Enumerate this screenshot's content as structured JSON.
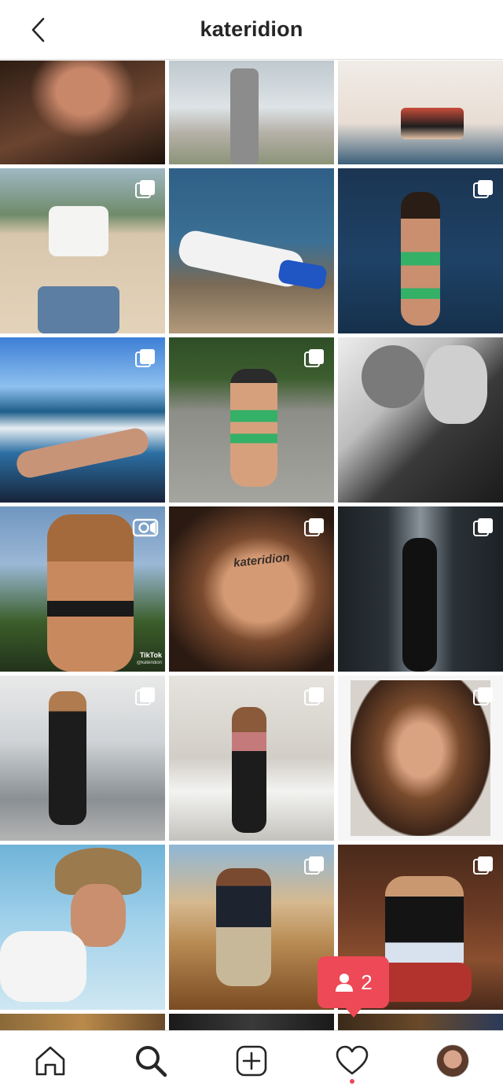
{
  "header": {
    "title": "kateridion",
    "back_icon": "chevron-left-icon"
  },
  "grid": {
    "posts": [
      {
        "type": "photo",
        "overlay": "none"
      },
      {
        "type": "photo",
        "overlay": "none"
      },
      {
        "type": "photo",
        "overlay": "none"
      },
      {
        "type": "carousel",
        "overlay": "carousel-icon"
      },
      {
        "type": "photo",
        "overlay": "none"
      },
      {
        "type": "carousel",
        "overlay": "carousel-icon"
      },
      {
        "type": "carousel",
        "overlay": "carousel-icon"
      },
      {
        "type": "carousel",
        "overlay": "carousel-icon"
      },
      {
        "type": "photo",
        "overlay": "none"
      },
      {
        "type": "video",
        "overlay": "video-camera-icon",
        "watermark": "TikTok",
        "watermark_handle": "@kateridion"
      },
      {
        "type": "carousel",
        "overlay": "carousel-icon",
        "image_text": "kateridion"
      },
      {
        "type": "carousel",
        "overlay": "carousel-icon"
      },
      {
        "type": "carousel",
        "overlay": "carousel-icon"
      },
      {
        "type": "carousel",
        "overlay": "carousel-icon"
      },
      {
        "type": "carousel",
        "overlay": "carousel-icon"
      },
      {
        "type": "photo",
        "overlay": "none"
      },
      {
        "type": "carousel",
        "overlay": "carousel-icon"
      },
      {
        "type": "carousel",
        "overlay": "carousel-icon"
      }
    ]
  },
  "toast": {
    "icon": "person-icon",
    "count": "2",
    "color": "#ed4956"
  },
  "tabbar": {
    "items": [
      {
        "name": "home",
        "icon": "home-icon"
      },
      {
        "name": "search",
        "icon": "search-icon",
        "active": true
      },
      {
        "name": "new-post",
        "icon": "plus-square-icon"
      },
      {
        "name": "activity",
        "icon": "heart-icon",
        "has_notification": true
      },
      {
        "name": "profile",
        "icon": "avatar"
      }
    ]
  }
}
